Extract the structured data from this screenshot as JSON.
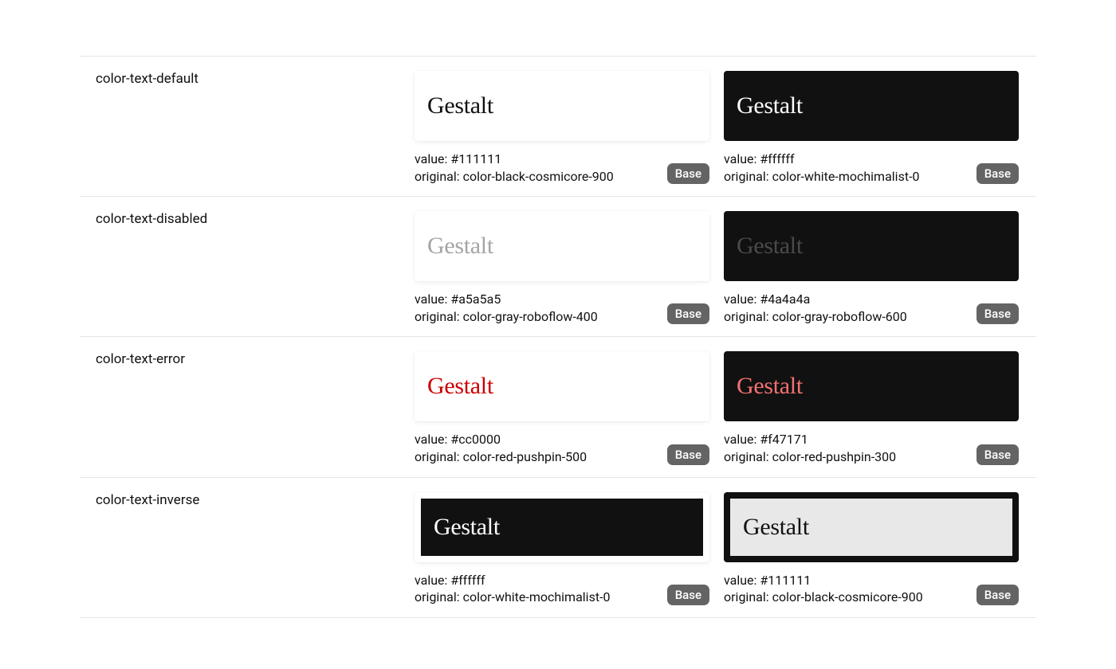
{
  "sample_text": "Gestalt",
  "value_label": "value: ",
  "original_label": "original: ",
  "badge_label": "Base",
  "tokens": [
    {
      "name": "color-text-default",
      "light": {
        "value": "#111111",
        "original": "color-black-cosmicore-900",
        "bg": "#ffffff",
        "fg": "#111111",
        "inverse": false
      },
      "dark": {
        "value": "#ffffff",
        "original": "color-white-mochimalist-0",
        "bg": "#111111",
        "fg": "#ffffff",
        "inverse": false
      }
    },
    {
      "name": "color-text-disabled",
      "light": {
        "value": "#a5a5a5",
        "original": "color-gray-roboflow-400",
        "bg": "#ffffff",
        "fg": "#a5a5a5",
        "inverse": false
      },
      "dark": {
        "value": "#4a4a4a",
        "original": "color-gray-roboflow-600",
        "bg": "#111111",
        "fg": "#4a4a4a",
        "inverse": false
      }
    },
    {
      "name": "color-text-error",
      "light": {
        "value": "#cc0000",
        "original": "color-red-pushpin-500",
        "bg": "#ffffff",
        "fg": "#cc0000",
        "inverse": false
      },
      "dark": {
        "value": "#f47171",
        "original": "color-red-pushpin-300",
        "bg": "#111111",
        "fg": "#f47171",
        "inverse": false
      }
    },
    {
      "name": "color-text-inverse",
      "light": {
        "value": "#ffffff",
        "original": "color-white-mochimalist-0",
        "bg": "#ffffff",
        "fg": "#ffffff",
        "inverse": true,
        "inner_bg": "#111111"
      },
      "dark": {
        "value": "#111111",
        "original": "color-black-cosmicore-900",
        "bg": "#111111",
        "fg": "#111111",
        "inverse": true,
        "inner_bg": "#e8e8e8"
      }
    }
  ]
}
